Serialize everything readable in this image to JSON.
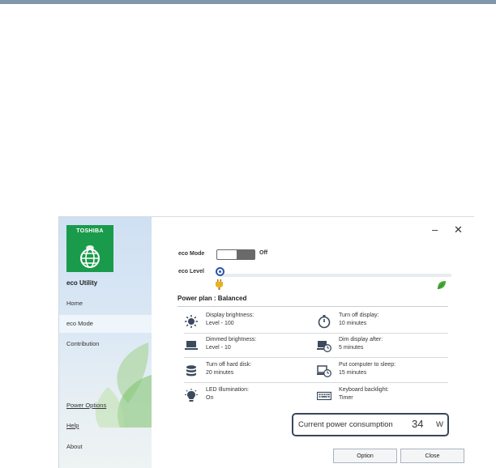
{
  "app": {
    "brand": "TOSHIBA",
    "name": "eco Utility"
  },
  "sidebar": {
    "items": [
      {
        "label": "Home",
        "active": false
      },
      {
        "label": "eco Mode",
        "active": true
      },
      {
        "label": "Contribution",
        "active": false
      }
    ],
    "links": {
      "power_options": "Power Options",
      "help": "Help",
      "about": "About"
    }
  },
  "window_controls": {
    "minimize": "–",
    "close": "✕"
  },
  "eco_mode": {
    "label": "eco Mode",
    "state": "Off",
    "enabled": false
  },
  "eco_level": {
    "label": "eco Level",
    "level": 0
  },
  "power_plan": {
    "label": "Power plan : Balanced"
  },
  "settings": [
    {
      "title": "Display brightness:",
      "value": "Level - 100",
      "icon": "brightness-icon"
    },
    {
      "title": "Turn off display:",
      "value": "10 minutes",
      "icon": "timer-icon"
    },
    {
      "title": "Dimmed brightness:",
      "value": "Level - 10",
      "icon": "laptop-icon"
    },
    {
      "title": "Dim display after:",
      "value": "5 minutes",
      "icon": "dim-display-icon"
    },
    {
      "title": "Turn off hard disk:",
      "value": "20 minutes",
      "icon": "hard-disk-icon"
    },
    {
      "title": "Put computer to sleep:",
      "value": "15 minutes",
      "icon": "sleep-icon"
    },
    {
      "title": "LED Illumination:",
      "value": "On",
      "icon": "led-bulb-icon"
    },
    {
      "title": "Keyboard backlight:",
      "value": "Timer",
      "icon": "keyboard-icon"
    }
  ],
  "power_consumption": {
    "label": "Current power consumption",
    "value": "34",
    "unit": "W"
  },
  "buttons": {
    "option": "Option",
    "close": "Close"
  },
  "colors": {
    "brand_green": "#1a9b4c",
    "accent_blue": "#2a56a8",
    "frame": "#39475c",
    "topbar": "#7f96ad"
  }
}
